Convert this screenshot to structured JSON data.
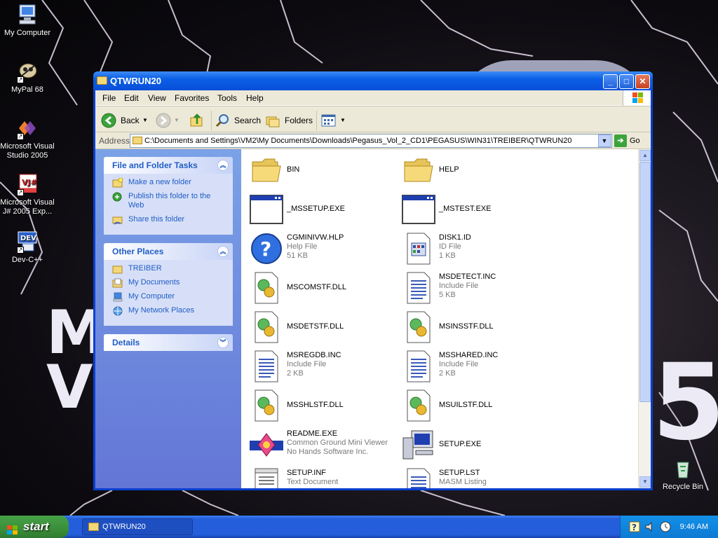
{
  "desktop": {
    "icons": [
      {
        "label": "My Computer"
      },
      {
        "label": "MyPal 68"
      },
      {
        "label": "Microsoft Visual Studio 2005"
      },
      {
        "label": "Microsoft Visual J# 2005 Exp..."
      },
      {
        "label": "Dev-C++"
      },
      {
        "label": "Recycle Bin"
      }
    ]
  },
  "window": {
    "title": "QTWRUN20",
    "menu": [
      "File",
      "Edit",
      "View",
      "Favorites",
      "Tools",
      "Help"
    ],
    "toolbar": {
      "back": "Back",
      "search": "Search",
      "folders": "Folders"
    },
    "address": {
      "label": "Address",
      "value": "C:\\Documents and Settings\\VM2\\My Documents\\Downloads\\Pegasus_Vol_2_CD1\\PEGASUS\\WIN31\\TREIBER\\QTWRUN20",
      "go": "Go"
    },
    "taskpane": {
      "file_tasks": {
        "title": "File and Folder Tasks",
        "items": [
          "Make a new folder",
          "Publish this folder to the Web",
          "Share this folder"
        ]
      },
      "other_places": {
        "title": "Other Places",
        "items": [
          "TREIBER",
          "My Documents",
          "My Computer",
          "My Network Places"
        ]
      },
      "details": {
        "title": "Details"
      }
    },
    "files": [
      {
        "name": "BIN",
        "type": "",
        "size": "",
        "icon": "folder-icon"
      },
      {
        "name": "HELP",
        "type": "",
        "size": "",
        "icon": "folder-icon"
      },
      {
        "name": "_MSSETUP.EXE",
        "type": "",
        "size": "",
        "icon": "exe-window-icon"
      },
      {
        "name": "_MSTEST.EXE",
        "type": "",
        "size": "",
        "icon": "exe-window-icon"
      },
      {
        "name": "CGMINIVW.HLP",
        "type": "Help File",
        "size": "51 KB",
        "icon": "help-file-icon"
      },
      {
        "name": "DISK1.ID",
        "type": "ID File",
        "size": "1 KB",
        "icon": "id-file-icon"
      },
      {
        "name": "MSCOMSTF.DLL",
        "type": "",
        "size": "",
        "icon": "dll-icon"
      },
      {
        "name": "MSDETECT.INC",
        "type": "Include File",
        "size": "5 KB",
        "icon": "text-file-icon"
      },
      {
        "name": "MSDETSTF.DLL",
        "type": "",
        "size": "",
        "icon": "dll-icon"
      },
      {
        "name": "MSINSSTF.DLL",
        "type": "",
        "size": "",
        "icon": "dll-icon"
      },
      {
        "name": "MSREGDB.INC",
        "type": "Include File",
        "size": "2 KB",
        "icon": "text-file-icon"
      },
      {
        "name": "MSSHARED.INC",
        "type": "Include File",
        "size": "2 KB",
        "icon": "text-file-icon"
      },
      {
        "name": "MSSHLSTF.DLL",
        "type": "",
        "size": "",
        "icon": "dll-icon"
      },
      {
        "name": "MSUILSTF.DLL",
        "type": "",
        "size": "",
        "icon": "dll-icon"
      },
      {
        "name": "README.EXE",
        "type": "Common Ground Mini Viewer",
        "size": "No Hands Software Inc.",
        "icon": "readme-exe-icon"
      },
      {
        "name": "SETUP.EXE",
        "type": "",
        "size": "",
        "icon": "setup-computer-icon"
      },
      {
        "name": "SETUP.INF",
        "type": "Text Document",
        "size": "",
        "icon": "text-doc-icon"
      },
      {
        "name": "SETUP.LST",
        "type": "MASM Listing",
        "size": "",
        "icon": "text-file-icon"
      }
    ]
  },
  "taskbar": {
    "start": "start",
    "task": "QTWRUN20",
    "clock": "9:46 AM"
  },
  "wallpaper": {
    "letters": [
      "M",
      "V",
      "5"
    ]
  },
  "colors": {
    "xp_blue": "#0a3fd0",
    "taskpane_link": "#215dc6",
    "start_green": "#3a8f3a"
  }
}
